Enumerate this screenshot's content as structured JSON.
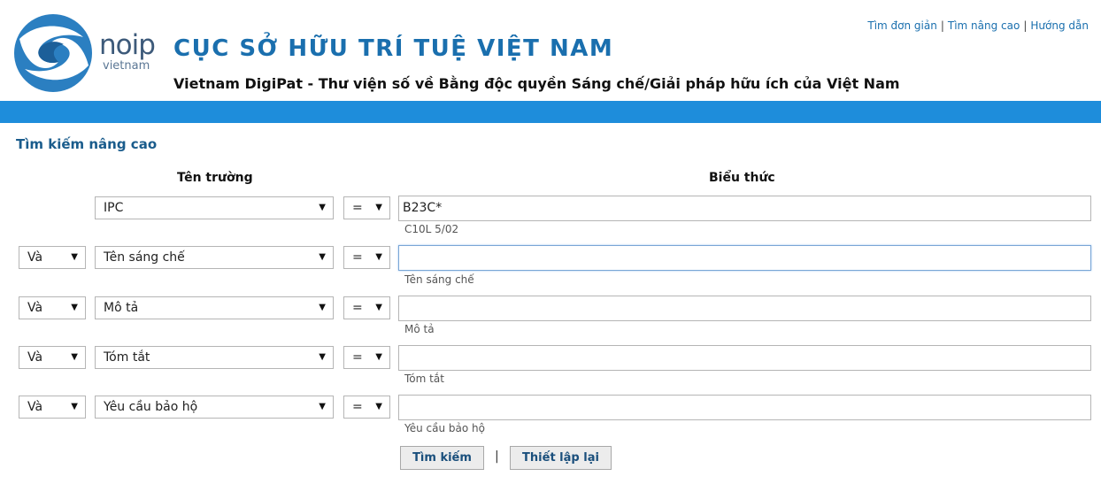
{
  "header": {
    "logo_text": "noip",
    "logo_sub": "vietnam",
    "title": "CỤC SỞ HỮU TRÍ TUỆ VIỆT NAM",
    "subtitle": "Vietnam DigiPat - Thư viện số về Bằng độc quyền Sáng chế/Giải pháp hữu ích của Việt Nam",
    "links": [
      "Tìm đơn giản",
      "Tìm nâng cao",
      "Hướng dẫn"
    ]
  },
  "search": {
    "section_title": "Tìm kiếm nâng cao",
    "col_field": "Tên trường",
    "col_expr": "Biểu thức",
    "rows": [
      {
        "logic": "",
        "field": "IPC",
        "op": "=",
        "value": "B23C*",
        "hint": "C10L 5/02"
      },
      {
        "logic": "Và",
        "field": "Tên sáng chế",
        "op": "=",
        "value": "",
        "hint": "Tên sáng chế"
      },
      {
        "logic": "Và",
        "field": "Mô tả",
        "op": "=",
        "value": "",
        "hint": "Mô tả"
      },
      {
        "logic": "Và",
        "field": "Tóm tắt",
        "op": "=",
        "value": "",
        "hint": "Tóm tắt"
      },
      {
        "logic": "Và",
        "field": "Yêu cầu bảo hộ",
        "op": "=",
        "value": "",
        "hint": "Yêu cầu bảo hộ"
      }
    ],
    "search_button": "Tìm kiếm",
    "reset_button": "Thiết lập lại",
    "button_separator": "|"
  },
  "icons": {
    "dropdown": "triangle-down-icon"
  },
  "colors": {
    "brand_blue": "#1a6fae",
    "bar_blue": "#1e8ddb"
  }
}
